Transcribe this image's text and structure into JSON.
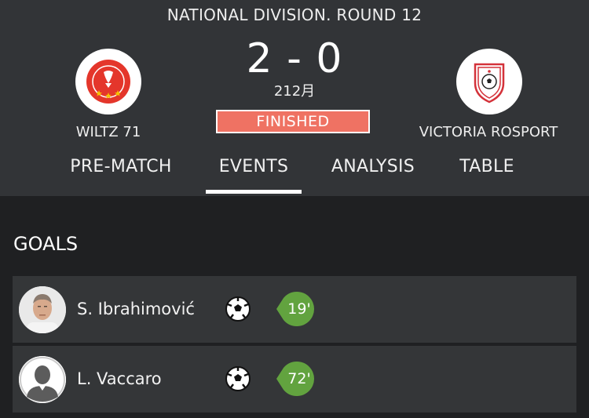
{
  "match": {
    "round_title": "NATIONAL DIVISION. ROUND 12",
    "score": "2 - 0",
    "date": "212月",
    "status": "FINISHED",
    "home_team": {
      "name": "WILTZ 71",
      "logo": "wiltz-71-crest-icon"
    },
    "away_team": {
      "name": "VICTORIA ROSPORT",
      "logo": "victoria-rosport-crest-icon"
    }
  },
  "tabs": [
    {
      "label": "PRE-MATCH",
      "active": false
    },
    {
      "label": "EVENTS",
      "active": true
    },
    {
      "label": "ANALYSIS",
      "active": false
    },
    {
      "label": "TABLE",
      "active": false
    }
  ],
  "goals": {
    "title": "GOALS",
    "items": [
      {
        "player": "S. Ibrahimović",
        "icon": "soccer-ball-icon",
        "minute": "19'",
        "avatar": "player-photo"
      },
      {
        "player": "L. Vaccaro",
        "icon": "soccer-ball-icon",
        "minute": "72'",
        "avatar": "player-placeholder"
      }
    ]
  },
  "colors": {
    "header_bg": "#323437",
    "page_bg": "#1f2022",
    "row_bg": "#343638",
    "status_badge": "#ef7263",
    "minute_badge": "#62a33f",
    "home_crest_red": "#e4362b"
  }
}
